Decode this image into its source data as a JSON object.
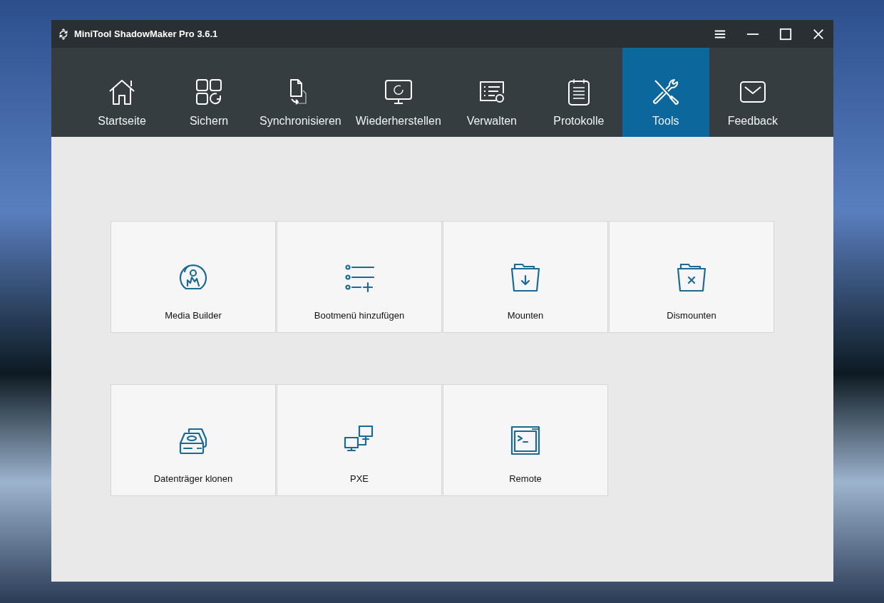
{
  "window": {
    "title": "MiniTool ShadowMaker Pro 3.6.1"
  },
  "tabs": [
    {
      "label": "Startseite",
      "kind": "home",
      "selected": false
    },
    {
      "label": "Sichern",
      "kind": "backup",
      "selected": false
    },
    {
      "label": "Synchronisieren",
      "kind": "sync",
      "selected": false
    },
    {
      "label": "Wiederherstellen",
      "kind": "restore",
      "selected": false
    },
    {
      "label": "Verwalten",
      "kind": "manage",
      "selected": false
    },
    {
      "label": "Protokolle",
      "kind": "logs",
      "selected": false
    },
    {
      "label": "Tools",
      "kind": "tools",
      "selected": true
    },
    {
      "label": "Feedback",
      "kind": "feedback",
      "selected": false
    }
  ],
  "tools": [
    [
      {
        "label": "Media Builder",
        "kind": "media"
      },
      {
        "label": "Bootmenü hinzufügen",
        "kind": "bootmenu"
      },
      {
        "label": "Mounten",
        "kind": "mount"
      },
      {
        "label": "Dismounten",
        "kind": "dismount"
      }
    ],
    [
      {
        "label": "Datenträger klonen",
        "kind": "clone"
      },
      {
        "label": "PXE",
        "kind": "pxe"
      },
      {
        "label": "Remote",
        "kind": "remote"
      }
    ]
  ]
}
